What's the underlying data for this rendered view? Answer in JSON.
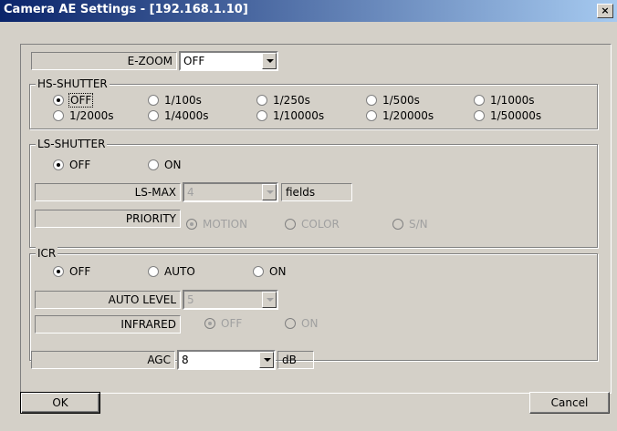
{
  "window": {
    "title": "Camera AE Settings - [192.168.1.10]",
    "close": "×"
  },
  "ezoom": {
    "label": "E-ZOOM",
    "value": "OFF"
  },
  "hs_shutter": {
    "legend": "HS-SHUTTER",
    "options": [
      "OFF",
      "1/100s",
      "1/250s",
      "1/500s",
      "1/1000s",
      "1/2000s",
      "1/4000s",
      "1/10000s",
      "1/20000s",
      "1/50000s"
    ],
    "selected": "OFF"
  },
  "ls_shutter": {
    "legend": "LS-SHUTTER",
    "options": [
      "OFF",
      "ON"
    ],
    "selected": "OFF",
    "ls_max": {
      "label": "LS-MAX",
      "value": "4",
      "unit": "fields"
    },
    "priority": {
      "label": "PRIORITY",
      "options": [
        "MOTION",
        "COLOR",
        "S/N"
      ],
      "selected": "MOTION"
    }
  },
  "icr": {
    "legend": "ICR",
    "options": [
      "OFF",
      "AUTO",
      "ON"
    ],
    "selected": "OFF",
    "auto_level": {
      "label": "AUTO LEVEL",
      "value": "5"
    },
    "infrared": {
      "label": "INFRARED",
      "options": [
        "OFF",
        "ON"
      ],
      "selected": "OFF"
    }
  },
  "agc": {
    "label": "AGC",
    "value": "8",
    "unit": "dB"
  },
  "buttons": {
    "ok": "OK",
    "cancel": "Cancel"
  }
}
